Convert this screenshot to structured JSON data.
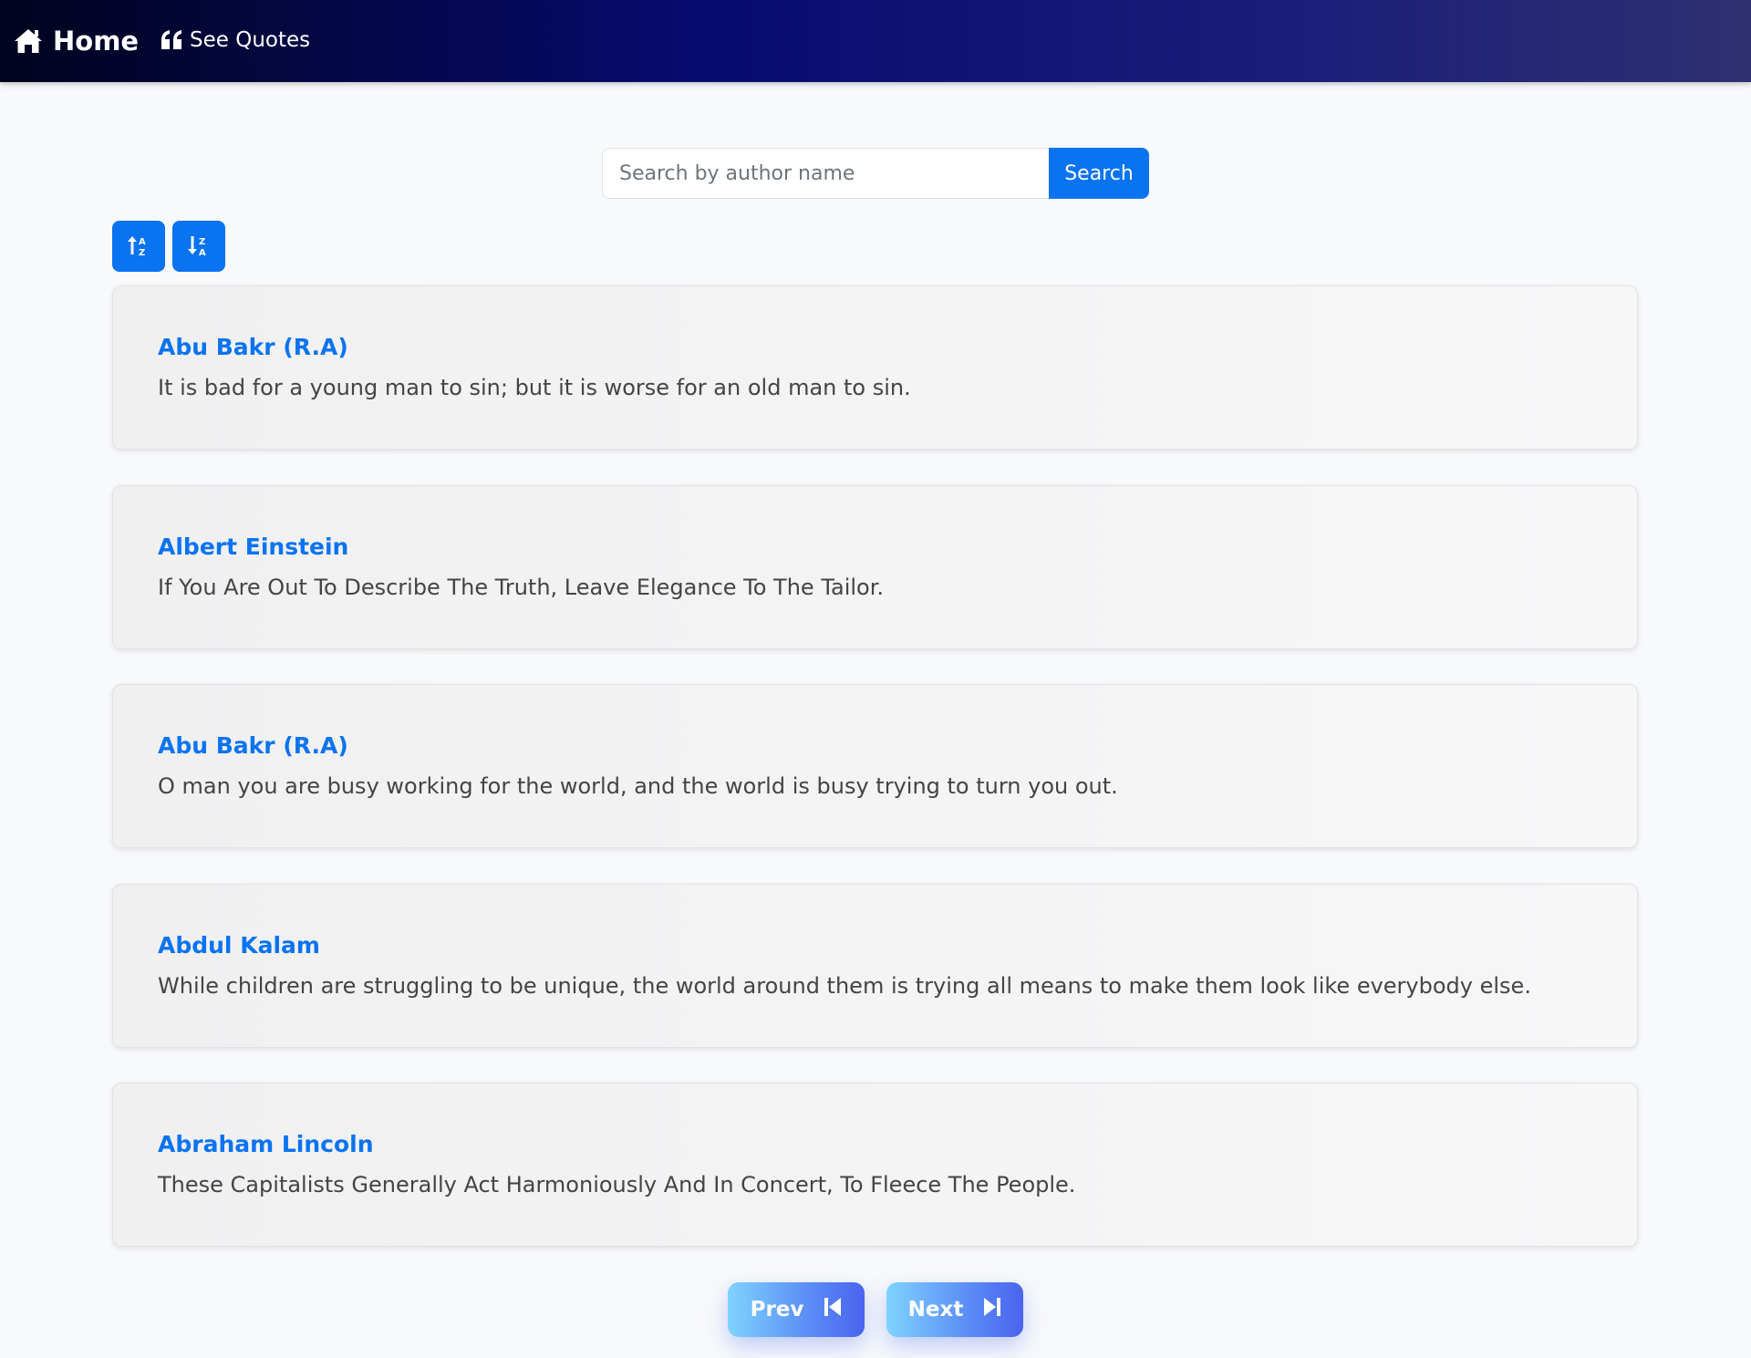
{
  "nav": {
    "home_label": "Home",
    "quotes_label": "See Quotes"
  },
  "search": {
    "placeholder": "Search by author name",
    "button_label": "Search"
  },
  "sort": {
    "asc_icon": "sort-alpha-up-icon",
    "desc_icon": "sort-alpha-down-icon"
  },
  "quotes": [
    {
      "author": "Abu Bakr (R.A)",
      "text": "It is bad for a young man to sin; but it is worse for an old man to sin."
    },
    {
      "author": "Albert Einstein",
      "text": "If You Are Out To Describe The Truth, Leave Elegance To The Tailor."
    },
    {
      "author": "Abu Bakr (R.A)",
      "text": "O man you are busy working for the world, and the world is busy trying to turn you out."
    },
    {
      "author": "Abdul Kalam",
      "text": "While children are struggling to be unique, the world around them is trying all means to make them look like everybody else."
    },
    {
      "author": "Abraham Lincoln",
      "text": "These Capitalists Generally Act Harmoniously And In Concert, To Fleece The People."
    }
  ],
  "pagination": {
    "prev_label": "Prev",
    "next_label": "Next"
  },
  "colors": {
    "accent": "#0a73f0",
    "navbar_start": "#02031f",
    "navbar_mid": "#060b6f"
  }
}
